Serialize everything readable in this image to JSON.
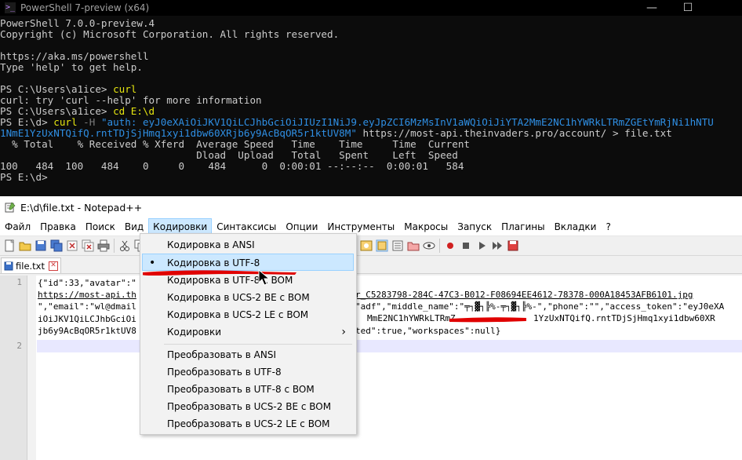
{
  "powershell": {
    "title": "PowerShell 7-preview (x64)",
    "win_min": "—",
    "win_max": "☐",
    "lines": [
      "PowerShell 7.0.0-preview.4",
      "Copyright (c) Microsoft Corporation. All rights reserved.",
      "",
      "https://aka.ms/powershell",
      "Type 'help' to get help.",
      "",
      "PS C:\\Users\\a1ice> ",
      "curl: try 'curl --help' for more information",
      "PS C:\\Users\\a1ice> ",
      "PS E:\\d> ",
      "",
      "  % Total    % Received % Xferd  Average Speed   Time    Time     Time  Current",
      "                                 Dload  Upload   Total   Spent    Left  Speed",
      "100   484  100   484    0     0    484      0  0:00:01 --:--:--  0:00:01   584",
      "PS E:\\d>"
    ],
    "cmd1": "curl",
    "cmd2": "cd E:\\d",
    "cmd3_curl": "curl",
    "cmd3_flag": " -H ",
    "cmd3_header_a": "\"auth: eyJ0eXAiOiJKV1QiLCJhbGciOiJIUzI1NiJ9.eyJpZCI6MzMsInV1aWQiOiJiYTA2MmE2NC1hYWRkLTRmZGEtYmRjNi1hNTU",
    "cmd3_header_b": "1NmE1YzUxNTQifQ.rntTDjSjHmq1xyi1dbw60XRjb6y9AcBqOR5r1ktUV8M\"",
    "cmd3_rest": " https://most-api.theinvaders.pro/account/ > file.txt"
  },
  "notepad": {
    "title": "E:\\d\\file.txt - Notepad++",
    "menu": [
      "Файл",
      "Правка",
      "Поиск",
      "Вид",
      "Кодировки",
      "Синтаксисы",
      "Опции",
      "Инструменты",
      "Макросы",
      "Запуск",
      "Плагины",
      "Вкладки",
      "?"
    ],
    "tab_label": "file.txt",
    "line_numbers": [
      "1",
      "2"
    ],
    "code_lines": [
      "{\"id\":33,\"avatar\":\"",
      "https://most-api.th",
      "\",\"email\":\"wl@dmail",
      "iOiJKV1QiLCJhbGciOi",
      "jb6y9AcBqOR5r1ktUV8"
    ],
    "code_right": [
      "r_C5283798-284C-47C3-B012-F08694EE4612-78378-000A18453AFB6101.jpg",
      "\"adf\",\"middle_name\":\"╤┐▓┐╠%-╤┐▓┐╠%-\",\"phone\":\"\",\"access_token\":\"eyJ0eXA",
      "MmE2NC1hYWRkLTRmZ",
      "1YzUxNTQifQ.rntTDjSjHmq1xyi1dbw60XR",
      "ted\":true,\"workspaces\":null}"
    ]
  },
  "encoding_menu": {
    "items": [
      {
        "label": "Кодировка в ANSI"
      },
      {
        "label": "Кодировка в UTF-8"
      },
      {
        "label": "Кодировка в UTF-8 с BOM"
      },
      {
        "label": "Кодировка в UCS-2 BE с BOM"
      },
      {
        "label": "Кодировка в UCS-2 LE с BOM"
      },
      {
        "label": "Кодировки"
      },
      {
        "label": "Преобразовать в ANSI"
      },
      {
        "label": "Преобразовать в UTF-8"
      },
      {
        "label": "Преобразовать в UTF-8 с BOM"
      },
      {
        "label": "Преобразовать в UCS-2 BE с BOM"
      },
      {
        "label": "Преобразовать в UCS-2 LE с BOM"
      }
    ],
    "selected": "Кодировка в UTF-8",
    "submenu_arrow": "›",
    "bullet": "•"
  },
  "colors": {
    "ps_bg": "#0c0c0c",
    "ps_yellow": "#e5e510",
    "ps_blue": "#2f8fe4",
    "menu_highlight": "#cce8ff",
    "annotation_red": "#e00000"
  }
}
